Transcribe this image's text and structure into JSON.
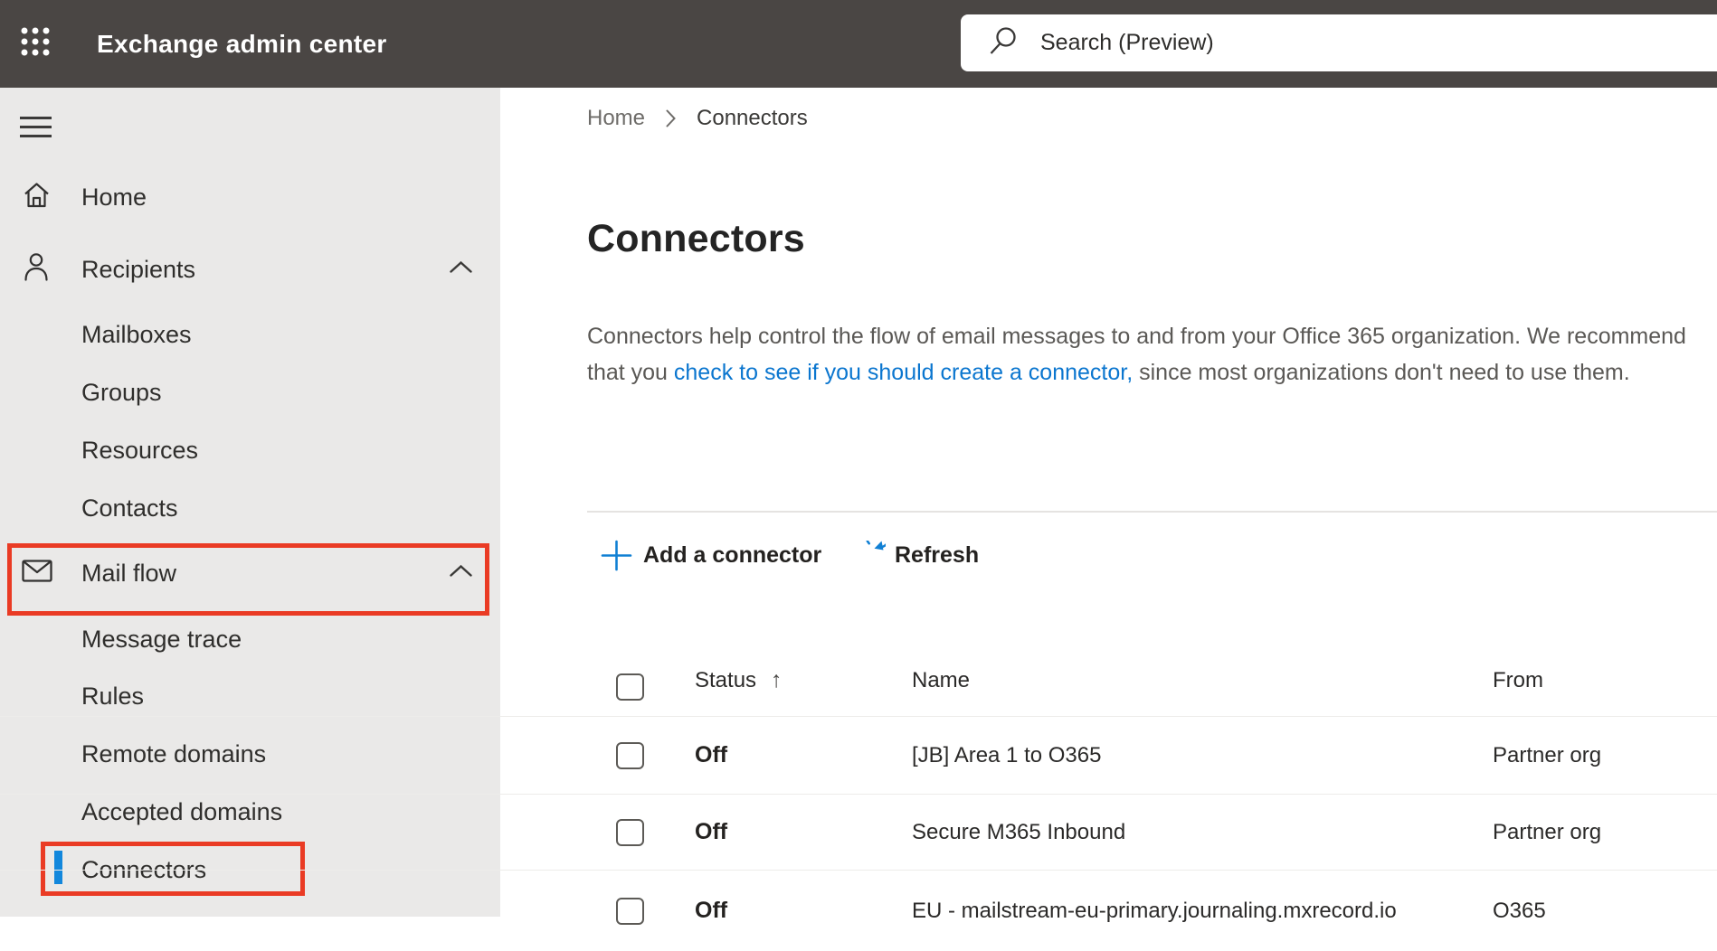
{
  "topbar": {
    "title": "Exchange admin center",
    "search": {
      "placeholder": "Search (Preview)"
    }
  },
  "sidebar": {
    "items": [
      {
        "label": "Home",
        "icon": "home",
        "level": 0
      },
      {
        "label": "Recipients",
        "icon": "person",
        "level": 0,
        "expanded": true
      },
      {
        "label": "Mailboxes",
        "level": 1
      },
      {
        "label": "Groups",
        "level": 1
      },
      {
        "label": "Resources",
        "level": 1
      },
      {
        "label": "Contacts",
        "level": 1
      },
      {
        "label": "Mail flow",
        "icon": "mail",
        "level": 0,
        "expanded": true,
        "annotated": true
      },
      {
        "label": "Message trace",
        "level": 1
      },
      {
        "label": "Rules",
        "level": 1
      },
      {
        "label": "Remote domains",
        "level": 1
      },
      {
        "label": "Accepted domains",
        "level": 1
      },
      {
        "label": "Connectors",
        "level": 1,
        "selected": true,
        "annotated": true
      }
    ]
  },
  "breadcrumb": {
    "items": [
      "Home",
      "Connectors"
    ]
  },
  "page": {
    "title": "Connectors",
    "description": {
      "text_before": "Connectors help control the flow of email messages to and from your Office 365 organization. We recommend that you ",
      "link_text": "check to see if you should create a connector,",
      "text_after": " since most organizations don't need to use them."
    }
  },
  "toolbar": {
    "add_label": "Add a connector",
    "refresh_label": "Refresh"
  },
  "table": {
    "columns": [
      "Status",
      "Name",
      "From"
    ],
    "sort": {
      "column": "Status",
      "direction": "asc",
      "indicator": "↑"
    },
    "rows": [
      {
        "status": "Off",
        "name": "[JB] Area 1 to O365",
        "from": "Partner org"
      },
      {
        "status": "Off",
        "name": "Secure M365 Inbound",
        "from": "Partner org"
      },
      {
        "status": "Off",
        "name": "EU - mailstream-eu-primary.journaling.mxrecord.io",
        "from": "O365"
      }
    ]
  },
  "colors": {
    "topbar_bg": "#4a4644",
    "sidebar_bg": "#eae9e8",
    "accent_blue": "#1287dc",
    "link_blue": "#0b76cf",
    "icon_blue": "#1180d4",
    "annotation_red": "#ea3b24",
    "text_dark": "#242424",
    "text_gray": "#5a5855"
  }
}
